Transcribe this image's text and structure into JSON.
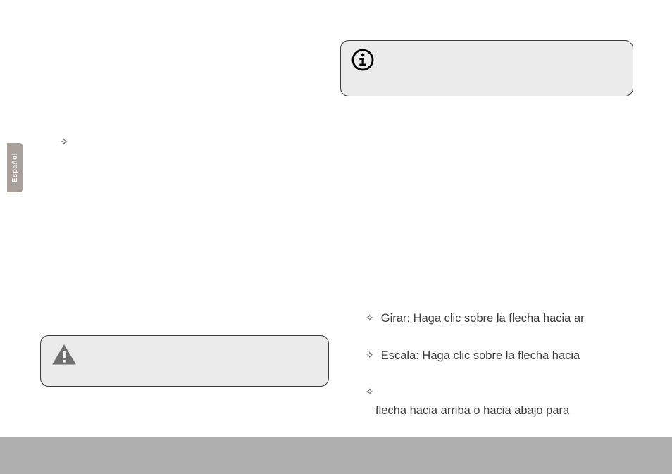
{
  "sideTab": {
    "label": "Español"
  },
  "notes": {
    "topIconName": "info",
    "bottomIconName": "warning"
  },
  "leftColumn": {
    "item1": ""
  },
  "rightColumn": {
    "item1": "Girar: Haga clic sobre la flecha hacia ar",
    "item2": "Escala: Haga clic sobre la flecha hacia",
    "item3_line1": "",
    "item3_line2": "flecha hacia arriba o hacia abajo para"
  }
}
